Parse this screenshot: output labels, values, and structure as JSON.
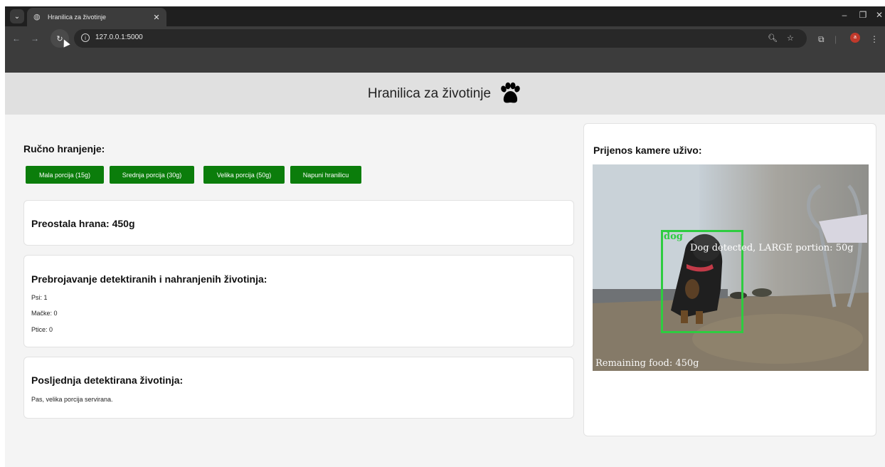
{
  "browser": {
    "tab_title": "Hranilica za životinje",
    "url": "127.0.0.1:5000"
  },
  "header": {
    "title": "Hranilica za životinje"
  },
  "manual_feeding": {
    "title": "Ručno hranjenje:",
    "buttons": [
      {
        "label": "Mala porcija (15g)"
      },
      {
        "label": "Srednja porcija (30g)"
      },
      {
        "label": "Velika porcija (50g)"
      },
      {
        "label": "Napuni hranilicu"
      }
    ]
  },
  "remaining_food": {
    "title": "Preostala hrana: 450g"
  },
  "counts": {
    "title": "Prebrojavanje detektiranih i nahranjenih životinja:",
    "dogs": "Psi: 1",
    "cats": "Mačke: 0",
    "birds": "Ptice: 0"
  },
  "last_detected": {
    "title": "Posljednja detektirana životinja:",
    "text": "Pas, velika porcija servirana."
  },
  "camera": {
    "title": "Prijenos kamere uživo:",
    "overlay_label": "dog",
    "overlay_detected": "Dog detected, LARGE portion: 50g",
    "overlay_remaining": "Remaining food: 450g"
  },
  "colors": {
    "button_green": "#0b7d0b",
    "bbox_green": "#2ecc40",
    "header_bg": "#e0e0e0",
    "page_bg": "#f4f4f4"
  }
}
